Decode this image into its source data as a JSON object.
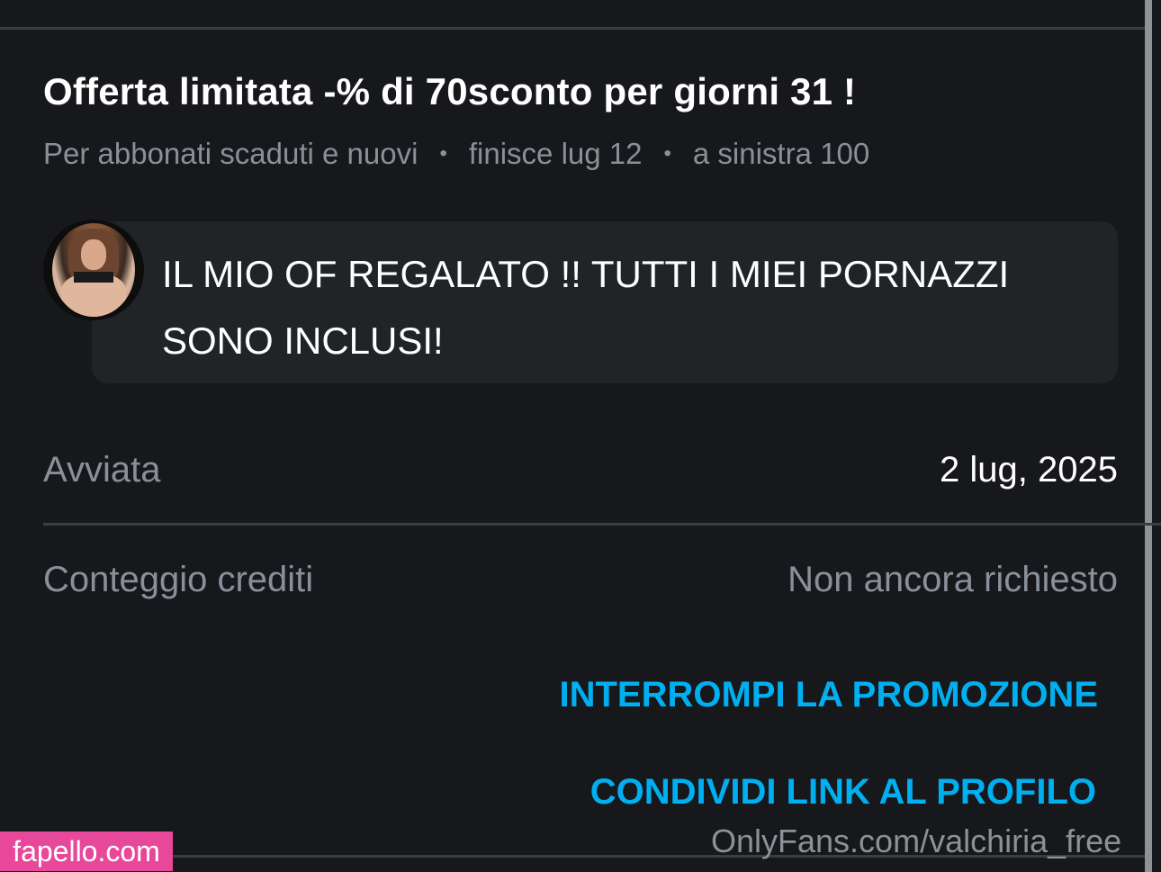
{
  "promo": {
    "title": "Offerta limitata -% di 70sconto per giorni 31 !",
    "audience": "Per abbonati scaduti e nuovi",
    "ends": "finisce lug 12",
    "remaining": "a sinistra 100",
    "separator": "•"
  },
  "message": {
    "text": "IL MIO OF REGALATO !! TUTTI I MIEI PORNAZZI SONO INCLUSI!",
    "avatar_icon": "profile-photo"
  },
  "details": {
    "started_label": "Avviata",
    "started_value": "2 lug, 2025",
    "credits_label": "Conteggio crediti",
    "credits_value": "Non ancora richiesto"
  },
  "actions": {
    "stop_label": "INTERROMPI LA PROMOZIONE",
    "share_label": "CONDIVIDI LINK AL PROFILO"
  },
  "watermarks": {
    "site": "fapello.com",
    "profile": "OnlyFans.com/valchiria_free"
  },
  "colors": {
    "background": "#17181b",
    "bubble": "#212427",
    "accent": "#00aff0",
    "muted_text": "#8a9099",
    "watermark_pink": "#e8489a"
  }
}
